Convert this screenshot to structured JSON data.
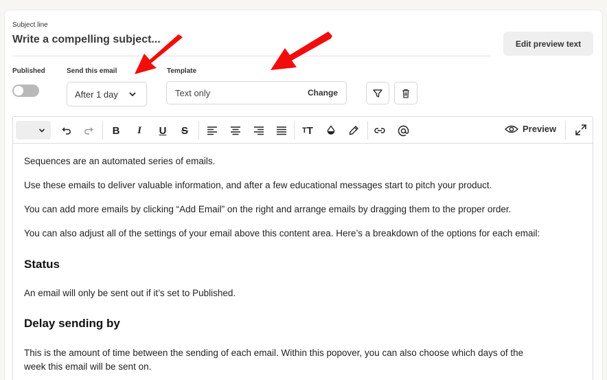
{
  "subject": {
    "label": "Subject line",
    "placeholder": "Write a compelling subject...",
    "edit_preview_label": "Edit preview text"
  },
  "published": {
    "label": "Published",
    "on": false
  },
  "send": {
    "label": "Send this email",
    "value": "After 1 day"
  },
  "template": {
    "label": "Template",
    "value": "Text only",
    "change_label": "Change"
  },
  "toolbar": {
    "format_select": "",
    "icons": [
      "undo-icon",
      "redo-icon",
      "bold-icon",
      "italic-icon",
      "underline-icon",
      "strikethrough-icon",
      "align-left-icon",
      "align-center-icon",
      "align-right-icon",
      "justify-icon",
      "font-size-icon",
      "color-drop-icon",
      "highlighter-icon",
      "link-icon",
      "mention-icon"
    ],
    "preview_label": "Preview"
  },
  "content": {
    "p1": "Sequences are an automated series of emails.",
    "p2": "Use these emails to deliver valuable information, and after a few educational messages start to pitch your product.",
    "p3": "You can add more emails by clicking “Add Email” on the right and arrange emails by dragging them to the proper order.",
    "p4": "You can also adjust all of the settings of your email above this content area. Here’s a breakdown of the options for each email:",
    "h1": "Status",
    "p5": "An email will only be sent out if it’s set to Published.",
    "h2": "Delay sending by",
    "p6_line1": "This is the amount of time between the sending of each email. Within this popover, you can also choose which days of the",
    "p6_line2": "week this email will be sent on."
  },
  "colors": {
    "arrow": "#f20d0d",
    "toggle_off": "#b9b9b9"
  }
}
